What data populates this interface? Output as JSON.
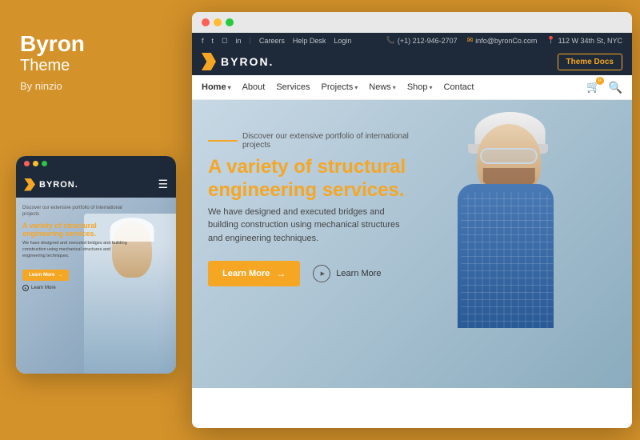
{
  "left": {
    "title": "Byron",
    "subtitle": "Theme",
    "author": "By ninzio"
  },
  "mobile": {
    "logo_text": "BYRON.",
    "hero_tagline": "Discover our extensive portfolio of international projects",
    "hero_title_1": "A variety of structural",
    "hero_title_2": "engineering services.",
    "hero_desc": "We have designed and executed bridges and building construction using mechanical structures and engineering techniques.",
    "btn_primary": "Learn More",
    "btn_secondary": "Learn More"
  },
  "browser": {
    "info_bar": {
      "careers": "Careers",
      "help_desk": "Help Desk",
      "login": "Login",
      "phone": "(+1) 212-946-2707",
      "email": "info@byronCo.com",
      "address": "112 W 34th St, NYC"
    },
    "nav": {
      "logo_text": "BYRON.",
      "theme_docs": "Theme Docs"
    },
    "page_nav": {
      "links": [
        "Home",
        "About",
        "Services",
        "Projects",
        "News",
        "Shop",
        "Contact"
      ]
    },
    "hero": {
      "tagline": "Discover our extensive portfolio of international projects",
      "title_1": "A variety of structural",
      "title_2": "engineering services.",
      "desc": "We have designed and executed bridges and building construction using mechanical structures and engineering techniques.",
      "btn_primary": "Learn More",
      "btn_secondary": "Learn More"
    }
  },
  "colors": {
    "accent": "#F5A623",
    "dark_navy": "#1e2a3a",
    "bg_gold": "#D4922A"
  }
}
